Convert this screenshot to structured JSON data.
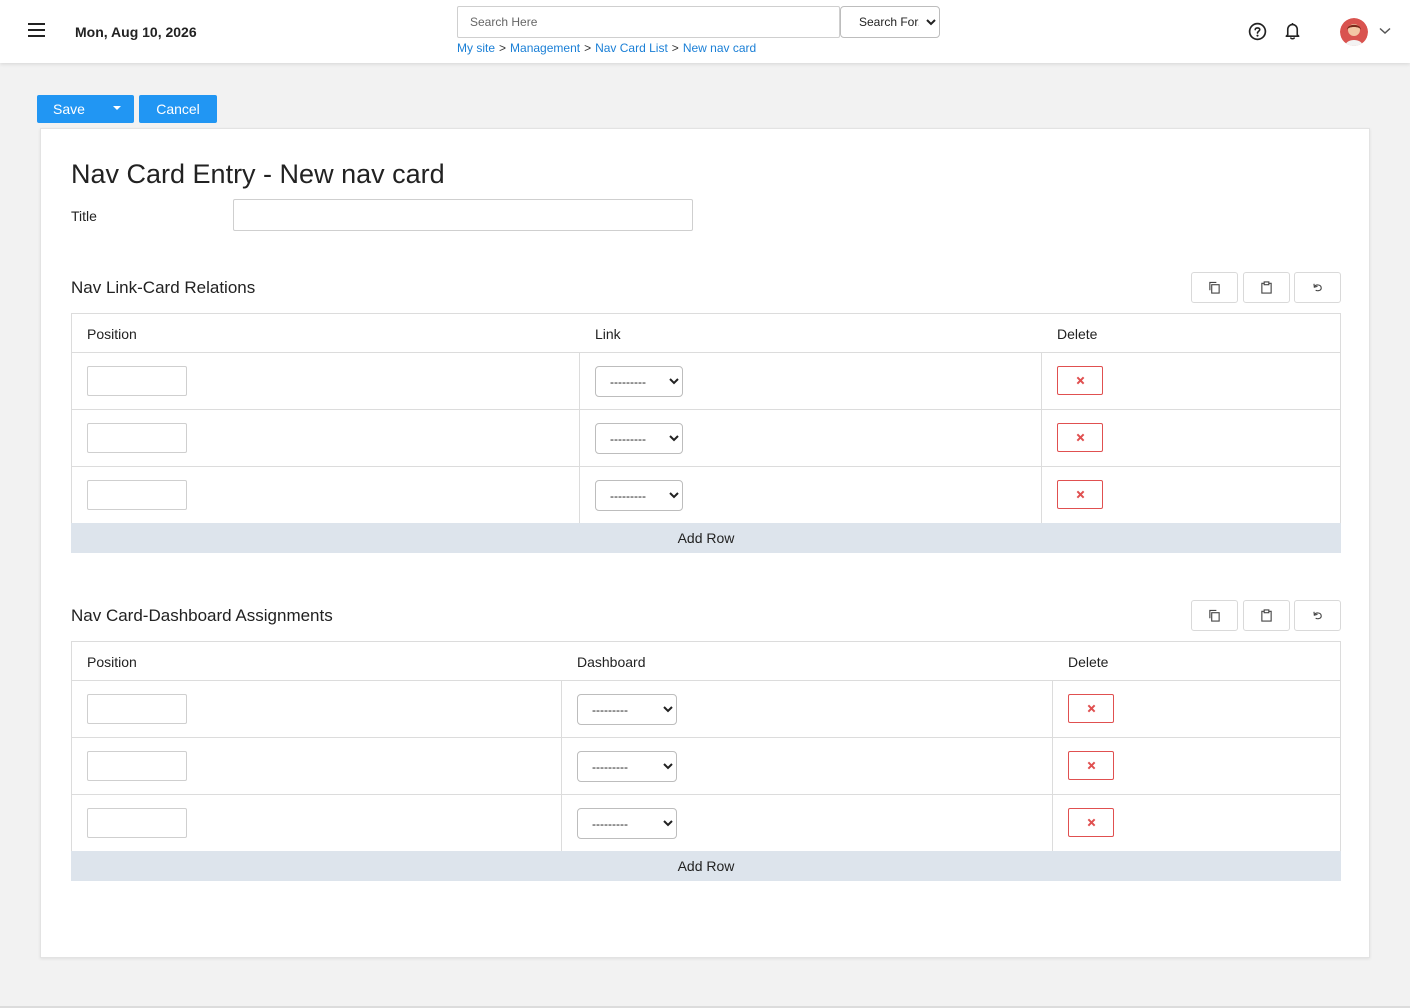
{
  "header": {
    "date": "Mon, Aug 10, 2026",
    "search_placeholder": "Search Here",
    "search_select": "Search For...",
    "breadcrumb": [
      "My site",
      "Management",
      "Nav Card List",
      "New nav card"
    ],
    "breadcrumb_sep": ">"
  },
  "actions": {
    "save_label": "Save",
    "cancel_label": "Cancel"
  },
  "form": {
    "page_title": "Nav Card Entry - New nav card",
    "title_label": "Title",
    "title_value": ""
  },
  "sections": [
    {
      "title": "Nav Link-Card Relations",
      "columns": [
        "Position",
        "Link",
        "Delete"
      ],
      "rows": [
        {
          "position": "",
          "link": "---------"
        },
        {
          "position": "",
          "link": "---------"
        },
        {
          "position": "",
          "link": "---------"
        }
      ],
      "add_row_label": "Add Row"
    },
    {
      "title": "Nav Card-Dashboard Assignments",
      "columns": [
        "Position",
        "Dashboard",
        "Delete"
      ],
      "rows": [
        {
          "position": "",
          "dashboard": "---------"
        },
        {
          "position": "",
          "dashboard": "---------"
        },
        {
          "position": "",
          "dashboard": "---------"
        }
      ],
      "add_row_label": "Add Row"
    }
  ],
  "icons": {
    "menu": "hamburger-icon",
    "help": "help-circle-icon",
    "notifications": "bell-icon",
    "user": "avatar",
    "copy": "copy-icon",
    "paste": "clipboard-icon",
    "undo": "undo-icon",
    "delete": "x-icon"
  },
  "colors": {
    "primary": "#2196f3",
    "link": "#1a7fd6",
    "danger": "#e05050",
    "add_row_bg": "#dde4ec"
  }
}
